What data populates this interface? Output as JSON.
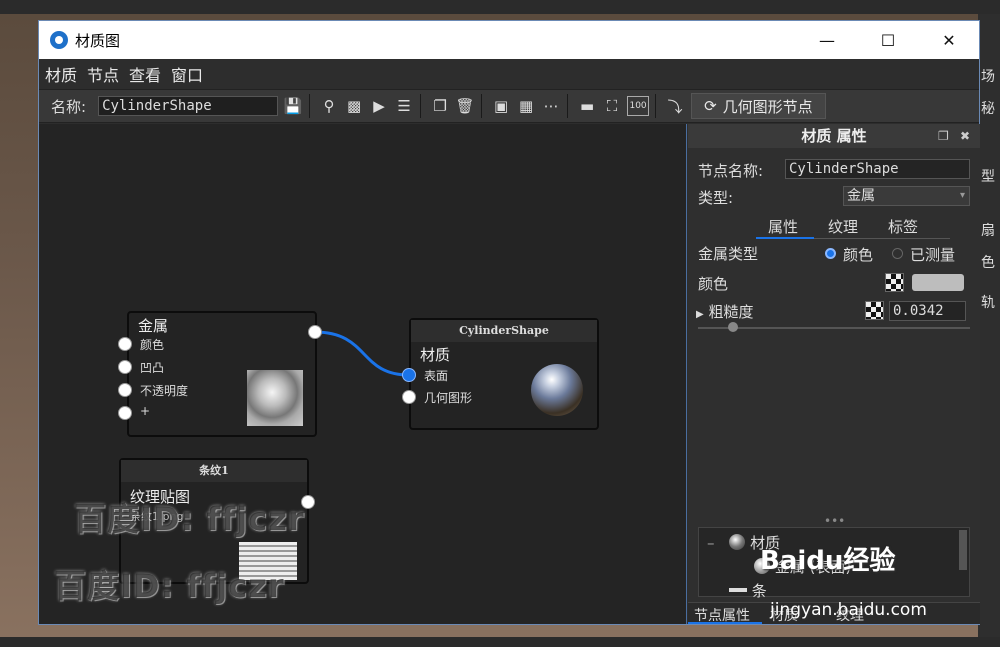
{
  "window": {
    "title": "材质图"
  },
  "menu": [
    "材质",
    "节点",
    "查看",
    "窗口"
  ],
  "toolbar": {
    "name_label": "名称:",
    "name_value": "CylinderShape",
    "geometry_button": "几何图形节点",
    "icons": [
      "save-icon",
      "search-icon",
      "checker-icon",
      "play-icon",
      "sliders-icon",
      "copy-icon",
      "trash-icon",
      "node-add-icon",
      "grid-icon",
      "dots-icon",
      "align-icon",
      "frame-icon",
      "zoom-100-icon",
      "route-icon"
    ],
    "zoom_label": "100"
  },
  "graph": {
    "metal_node": {
      "title": "金属",
      "ports": [
        "颜色",
        "凹凸",
        "不透明度",
        "+"
      ]
    },
    "material_node": {
      "header": "CylinderShape",
      "title": "材质",
      "ports": [
        "表面",
        "几何图形"
      ]
    },
    "stripe_node": {
      "header": "条纹1",
      "title": "纹理贴图",
      "file": "条纹1.png"
    }
  },
  "watermark": [
    "百度ID: ffjczr",
    "百度ID: ffjczr"
  ],
  "panel": {
    "title": "材质 属性",
    "node_name_label": "节点名称:",
    "node_name_value": "CylinderShape",
    "type_label": "类型:",
    "type_value": "金属",
    "tabs": [
      "属性",
      "纹理",
      "标签"
    ],
    "metal_type_label": "金属类型",
    "metal_type_options": [
      "颜色",
      "已测量"
    ],
    "metal_type_selected": "颜色",
    "color_label": "颜色",
    "color_value": "#bdbdbd",
    "roughness_label": "粗糙度",
    "roughness_value": "0.0342",
    "tree": [
      "材质",
      "金属 (表面)",
      "条"
    ],
    "bottom_tabs": [
      "节点属性",
      "材质",
      "纹理"
    ]
  },
  "background": {
    "right_chars": [
      "场",
      "秘",
      "型",
      "扇",
      "色",
      "轨"
    ]
  },
  "brand": {
    "baidu": "Baidu经验",
    "url": "jingyan.baidu.com"
  }
}
